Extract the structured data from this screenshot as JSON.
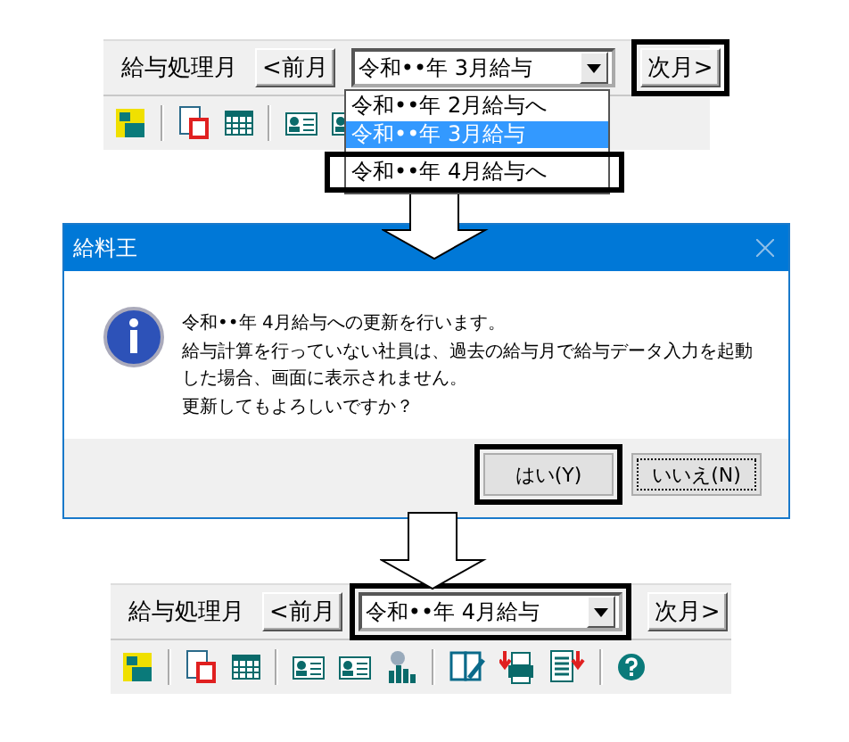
{
  "top_panel": {
    "label": "給与処理月",
    "prev_button": "<前月",
    "combo_value": "令和••年 3月給与",
    "next_button": {
      "label": "次月>",
      "highlighted": true
    },
    "dropdown": [
      {
        "label": "令和••年 2月給与へ",
        "selected": false,
        "highlighted": false
      },
      {
        "label": "令和••年 3月給与",
        "selected": true,
        "highlighted": false
      },
      {
        "label": "令和••年 4月給与へ",
        "selected": false,
        "highlighted": true
      }
    ]
  },
  "dialog": {
    "title": "給料王",
    "message_lines": [
      "令和••年 4月給与への更新を行います。",
      "給与計算を行っていない社員は、過去の給与月で給与データ入力を起動",
      "した場合、画面に表示されません。",
      "更新してもよろしいですか？"
    ],
    "buttons": [
      {
        "label": "はい(Y)",
        "focused": false,
        "highlighted": true
      },
      {
        "label": "いいえ(N)",
        "focused": true
      }
    ]
  },
  "bottom_panel": {
    "label": "給与処理月",
    "prev_button": "<前月",
    "combo_value": {
      "text": "令和••年 4月給与",
      "highlighted": true
    },
    "next_button": "次月>"
  }
}
